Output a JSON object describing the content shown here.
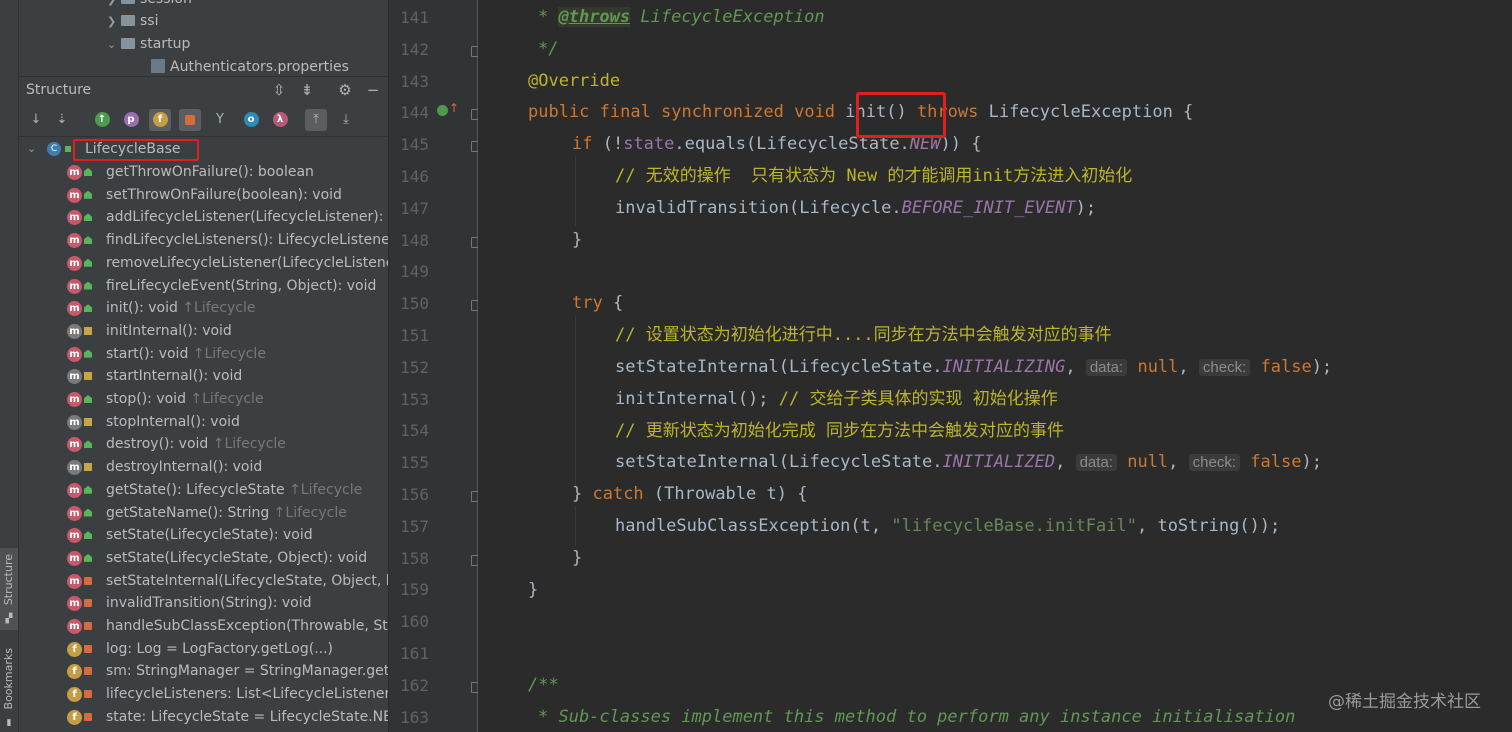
{
  "sidebar_tabs": {
    "structure": "Structure",
    "bookmarks": "Bookmarks"
  },
  "project_tree": {
    "items": [
      {
        "label": "session"
      },
      {
        "label": "ssi"
      },
      {
        "label": "startup"
      },
      {
        "label": "Authenticators.properties"
      }
    ]
  },
  "structure_panel": {
    "title": "Structure",
    "toolbar_icons": [
      "sort-by-visibility-icon",
      "sort-alphabetically-icon",
      "show-inherited-icon",
      "show-properties-icon",
      "show-fields-icon",
      "show-non-public-icon",
      "show-lambdas-icon",
      "show-anonymous-icon",
      "show-lambda-icon",
      "navigate-from-source-icon",
      "navigate-to-source-icon"
    ],
    "root": "LifecycleBase",
    "members": [
      {
        "name": "getThrowOnFailure(): boolean",
        "inherited": ""
      },
      {
        "name": "setThrowOnFailure(boolean): void",
        "inherited": ""
      },
      {
        "name": "addLifecycleListener(LifecycleListener): voi",
        "inherited": ""
      },
      {
        "name": "findLifecycleListeners(): LifecycleListener[]",
        "inherited": ""
      },
      {
        "name": "removeLifecycleListener(LifecycleListener):",
        "inherited": ""
      },
      {
        "name": "fireLifecycleEvent(String, Object): void",
        "inherited": ""
      },
      {
        "name": "init(): void ",
        "inherited": "↑Lifecycle"
      },
      {
        "name": "initInternal(): void",
        "inherited": ""
      },
      {
        "name": "start(): void ",
        "inherited": "↑Lifecycle"
      },
      {
        "name": "startInternal(): void",
        "inherited": ""
      },
      {
        "name": "stop(): void ",
        "inherited": "↑Lifecycle"
      },
      {
        "name": "stopInternal(): void",
        "inherited": ""
      },
      {
        "name": "destroy(): void ",
        "inherited": "↑Lifecycle"
      },
      {
        "name": "destroyInternal(): void",
        "inherited": ""
      },
      {
        "name": "getState(): LifecycleState ",
        "inherited": "↑Lifecycle"
      },
      {
        "name": "getStateName(): String ",
        "inherited": "↑Lifecycle"
      },
      {
        "name": "setState(LifecycleState): void",
        "inherited": ""
      },
      {
        "name": "setState(LifecycleState, Object): void",
        "inherited": ""
      },
      {
        "name": "setStateInternal(LifecycleState, Object, boo",
        "inherited": ""
      },
      {
        "name": "invalidTransition(String): void",
        "inherited": ""
      },
      {
        "name": "handleSubClassException(Throwable, Strin",
        "inherited": ""
      },
      {
        "name": "log: Log = LogFactory.getLog(...)",
        "inherited": ""
      },
      {
        "name": "sm: StringManager = StringManager.getM",
        "inherited": ""
      },
      {
        "name": "lifecycleListeners: List<LifecycleListener> =",
        "inherited": ""
      },
      {
        "name": "state: LifecycleState = LifecycleState.NEW",
        "inherited": ""
      }
    ]
  },
  "editor": {
    "line_numbers": [
      "141",
      "142",
      "143",
      "144",
      "145",
      "146",
      "147",
      "148",
      "149",
      "150",
      "151",
      "152",
      "153",
      "154",
      "155",
      "156",
      "157",
      "158",
      "159",
      "160",
      "161",
      "162",
      "163"
    ],
    "watermark": "@稀土掘金技术社区",
    "hint_labels": {
      "data": "data:",
      "check": "check:"
    },
    "colors": {
      "keyword": "#cc7832",
      "annotation": "#bbb529",
      "comment": "#629755",
      "field": "#9876aa",
      "string": "#6a8759",
      "highlight_box": "#e02020"
    }
  }
}
